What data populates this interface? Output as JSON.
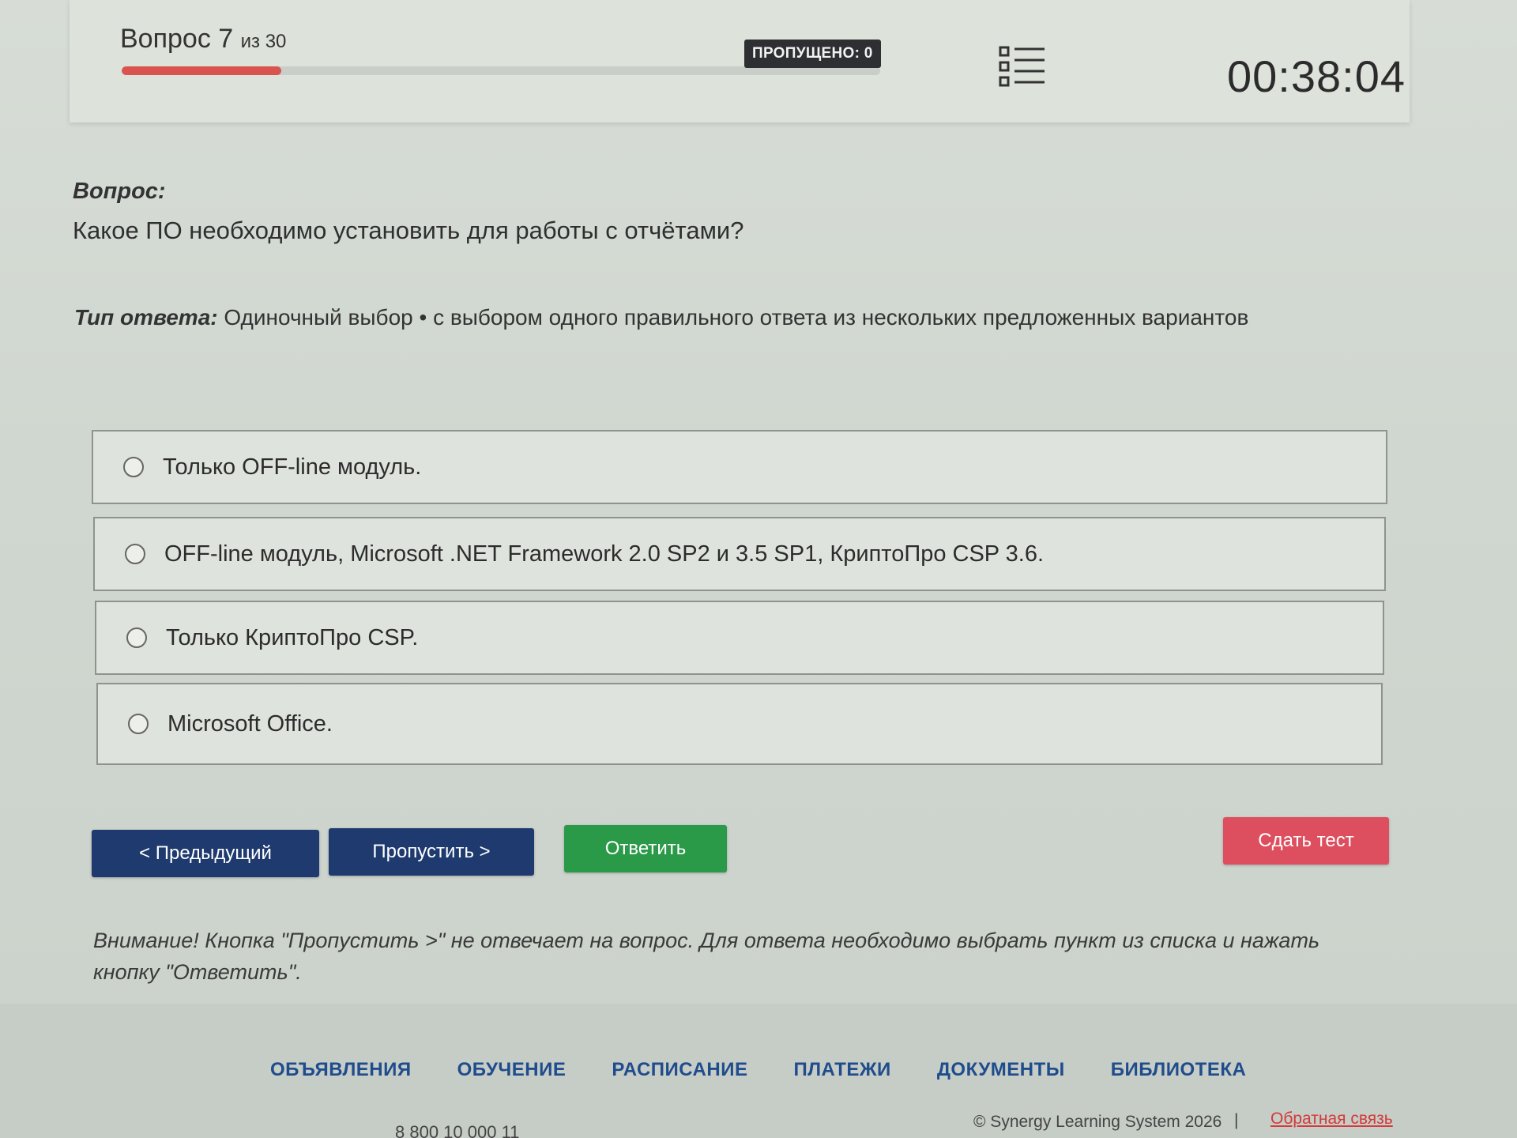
{
  "header": {
    "question_word": "Вопрос 7",
    "question_of": "из 30",
    "progress_fraction": 0.21,
    "skipped_label": "ПРОПУЩЕНО: 0",
    "timer": "00:38:04",
    "list_icon": "list-icon"
  },
  "question": {
    "heading": "Вопрос:",
    "text": "Какое ПО необходимо установить для работы с отчётами?",
    "answer_type_label": "Тип ответа:",
    "answer_type_value": " Одиночный выбор • с выбором одного правильного ответа из нескольких предложенных вариантов"
  },
  "options": [
    {
      "label": "Только OFF-line модуль."
    },
    {
      "label": "OFF-line модуль, Microsoft .NET Framework 2.0 SP2 и 3.5 SP1, КриптоПро CSP 3.6."
    },
    {
      "label": "Только КриптоПро CSP."
    },
    {
      "label": "Microsoft Office."
    }
  ],
  "buttons": {
    "prev": "< Предыдущий",
    "skip": "Пропустить >",
    "answer": "Ответить",
    "submit": "Сдать тест"
  },
  "warning": "Внимание! Кнопка \"Пропустить >\" не отвечает на вопрос. Для ответа необходимо выбрать пункт из списка и нажать кнопку \"Ответить\".",
  "footer": {
    "nav": [
      "ОБЪЯВЛЕНИЯ",
      "ОБУЧЕНИЕ",
      "РАСПИСАНИЕ",
      "ПЛАТЕЖИ",
      "ДОКУМЕНТЫ",
      "БИБЛИОТЕКА"
    ],
    "phone": "8 800 10 000 11",
    "copyright": "© Synergy Learning System 2026",
    "separator": "|",
    "feedback": "Обратная связь"
  },
  "colors": {
    "progress": "#d9534f",
    "nav_button": "#1e3a6e",
    "answer_button": "#2a9a48",
    "submit_button": "#dd4f5f",
    "nav_link": "#1f4c8c",
    "feedback_link": "#d43a3a"
  }
}
